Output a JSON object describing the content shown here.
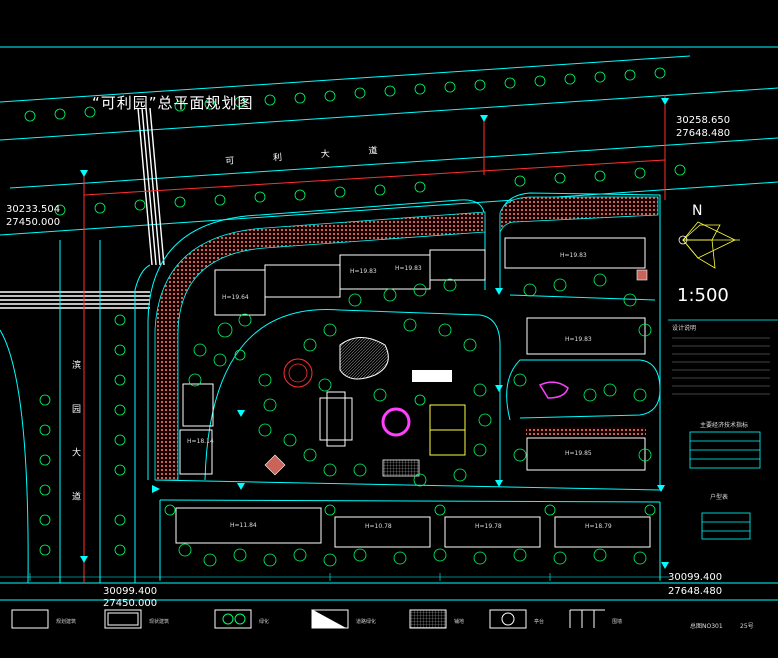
{
  "plan": {
    "title": "“可利园”总平面规划图",
    "scale": "1:500",
    "north": "N",
    "road_top": "可 利 大 道",
    "road_left": "滨 园 大 道"
  },
  "coords": {
    "top_right": [
      "30258.650",
      "27648.480"
    ],
    "top_left": [
      "30233.504",
      "27450.000"
    ],
    "bottom_left": [
      "30099.400",
      "27450.000"
    ],
    "bottom_right": [
      "30099.400",
      "27648.480"
    ]
  },
  "buildings": [
    {
      "label": "H=19.64"
    },
    {
      "label": "H=19.83"
    },
    {
      "label": "H=19.83"
    },
    {
      "label": "H=19.83"
    },
    {
      "label": "H=19.83"
    },
    {
      "label": "H=18.14"
    },
    {
      "label": "H=19.85"
    },
    {
      "label": "H=11.84"
    },
    {
      "label": "H=10.78"
    },
    {
      "label": "H=19.78"
    },
    {
      "label": "H=18.79"
    }
  ],
  "titleblock": {
    "notes_title": "设计说明",
    "table_title": "主要经济技术指标",
    "table2_title": "户型表",
    "drawing_no": "总图NO301",
    "sheet_no": "25号"
  },
  "legend": [
    {
      "label": "规划建筑"
    },
    {
      "label": "现状建筑"
    },
    {
      "label": "绿化"
    },
    {
      "label": "道路绿化"
    },
    {
      "label": "铺地"
    },
    {
      "label": "亭台"
    },
    {
      "label": "围墙"
    }
  ],
  "colors": {
    "line_cyan": "#00ffff",
    "line_white": "#ffffff",
    "paving": "#c8645a",
    "green": "#00cc44",
    "red": "#ff3030",
    "magenta": "#ff40ff",
    "yellow": "#ffff40"
  }
}
